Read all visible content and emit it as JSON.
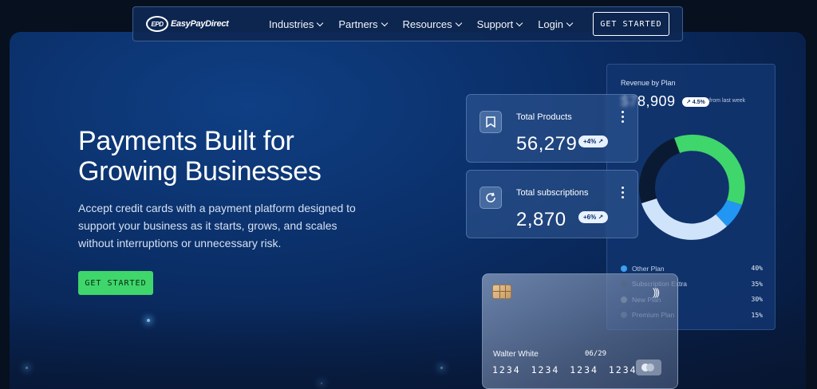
{
  "nav": {
    "logo_badge": "EPD",
    "logo_text": "EasyPayDirect",
    "items": [
      {
        "label": "Industries"
      },
      {
        "label": "Partners"
      },
      {
        "label": "Resources"
      },
      {
        "label": "Support"
      },
      {
        "label": "Login"
      }
    ],
    "cta_label": "GET STARTED"
  },
  "hero": {
    "headline_line1": "Payments Built for",
    "headline_line2": "Growing Businesses",
    "subtext": "Accept credit cards with a payment platform designed to support your business as it starts, grows, and scales without interruptions or unnecessary risk.",
    "cta_label": "GET STARTED"
  },
  "stats": [
    {
      "label": "Total Products",
      "value": "56,279",
      "badge": "+4% ↗",
      "icon": "bookmark-icon"
    },
    {
      "label": "Total subscriptions",
      "value": "2,870",
      "badge": "+6% ↗",
      "icon": "refresh-icon"
    }
  ],
  "revenue": {
    "title": "Revenue by Plan",
    "amount": "$78,909",
    "badge": "↗ 4.5%",
    "note": "from last week",
    "legend": [
      {
        "name": "Other Plan",
        "value": "40%",
        "color": "#3ba0f0"
      },
      {
        "name": "Subscription Extra",
        "value": "35%",
        "color": "#1a2436"
      },
      {
        "name": "New Plan",
        "value": "30%",
        "color": "#8a94a6"
      },
      {
        "name": "Premium Plan",
        "value": "15%",
        "color": "#5a6a85"
      }
    ]
  },
  "card": {
    "name": "Walter White",
    "expiry": "06/29",
    "number": "1234 1234 1234 1234"
  },
  "colors": {
    "accent_green": "#3fd66b",
    "donut_green": "#3fd66b",
    "donut_blue": "#2196f3",
    "donut_light": "#cfe4fb",
    "donut_dark": "#0b1a33"
  }
}
